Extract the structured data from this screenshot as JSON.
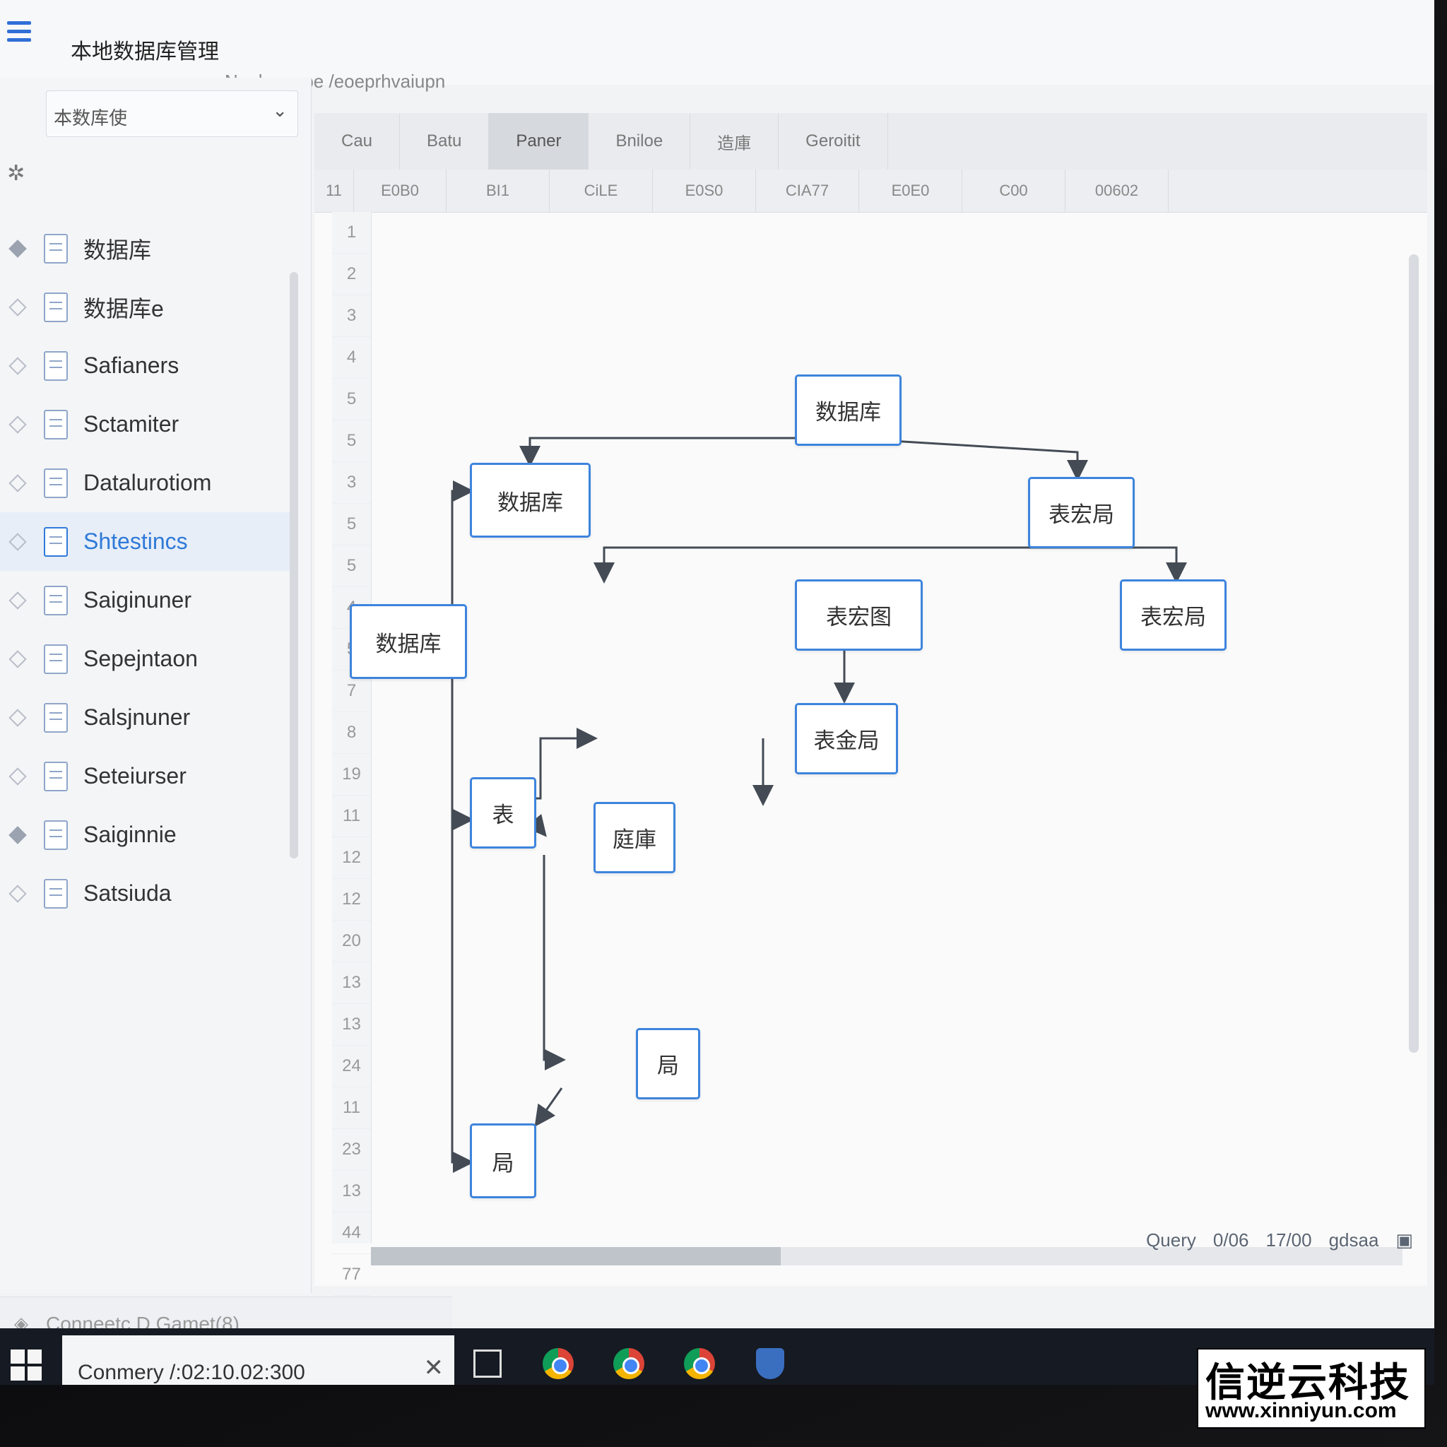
{
  "app": {
    "title": "本地数据库管理",
    "subtitle": "Nanlueegoe /eoeprhvaiupn"
  },
  "sidebar": {
    "db_select": "本数库使",
    "items": [
      {
        "label": "数据库",
        "diamond": "filled"
      },
      {
        "label": "数据库e",
        "diamond": "empty"
      },
      {
        "label": "Safianers",
        "diamond": "empty"
      },
      {
        "label": "Sctamiter",
        "diamond": "empty"
      },
      {
        "label": "Datalurotiom",
        "diamond": "empty"
      },
      {
        "label": "Shtestincs",
        "diamond": "empty",
        "active": true
      },
      {
        "label": "Saiginuner",
        "diamond": "empty"
      },
      {
        "label": "Sepejntaon",
        "diamond": "empty"
      },
      {
        "label": "Salsjnuner",
        "diamond": "empty"
      },
      {
        "label": "Seteiurser",
        "diamond": "empty"
      },
      {
        "label": "Saiginnie",
        "diamond": "filled"
      },
      {
        "label": "Satsiuda",
        "diamond": "empty"
      }
    ]
  },
  "tabs": [
    "Cau",
    "Batu",
    "Paner",
    "Bniloe",
    "造庫",
    "Geroitit"
  ],
  "columns": [
    "11",
    "E0B0",
    "BI1",
    "CiLE",
    "E0S0",
    "CIA77",
    "E0E0",
    "C00",
    "00602"
  ],
  "line_numbers": [
    "1",
    "2",
    "3",
    "4",
    "5",
    "5",
    "3",
    "5",
    "5",
    "4",
    "5",
    "7",
    "8",
    "19",
    "11",
    "12",
    "12",
    "20",
    "13",
    "13",
    "24",
    "11",
    "23",
    "13",
    "44",
    "77"
  ],
  "diagram": {
    "nodes": [
      {
        "id": "n1",
        "label": "数据库"
      },
      {
        "id": "n2",
        "label": "数据库"
      },
      {
        "id": "n3",
        "label": "表宏局"
      },
      {
        "id": "n4",
        "label": "数据库"
      },
      {
        "id": "n5",
        "label": "表宏图"
      },
      {
        "id": "n6",
        "label": "表宏局"
      },
      {
        "id": "n7",
        "label": "表金局"
      },
      {
        "id": "n8",
        "label": "表"
      },
      {
        "id": "n9",
        "label": "庭庫"
      },
      {
        "id": "n10",
        "label": "局"
      },
      {
        "id": "n11",
        "label": "局"
      }
    ]
  },
  "status": {
    "query": "Query",
    "a": "0/06",
    "b": "17/00",
    "c": "gdsaa"
  },
  "connection": {
    "label": "Conneetc D Gamet(8)",
    "field": "Conmery /:02:10.02:300"
  },
  "watermark": {
    "cn": "信逆云科技",
    "url": "www.xinniyun.com"
  },
  "colors": {
    "accent": "#3d84dd",
    "taskbar": "#161a22"
  }
}
